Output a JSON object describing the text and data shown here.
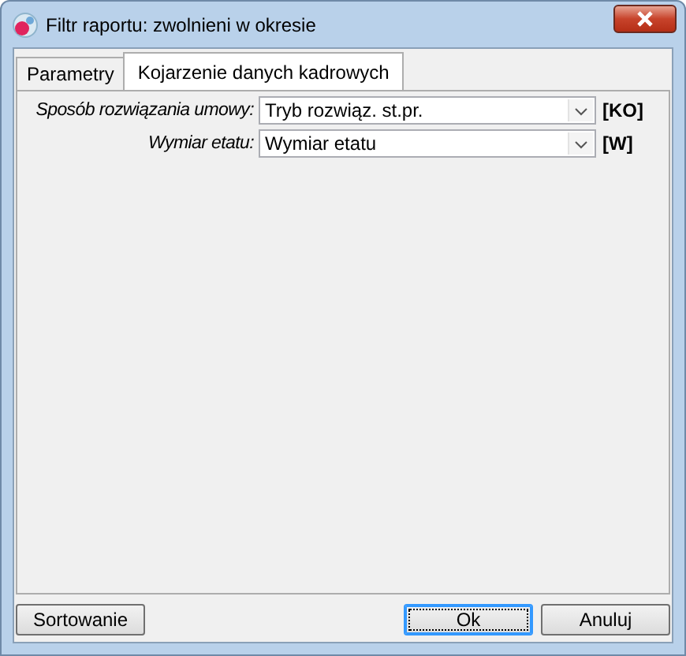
{
  "window": {
    "title": "Filtr raportu: zwolnieni w okresie"
  },
  "tabs": [
    {
      "label": "Parametry",
      "selected": false
    },
    {
      "label": "Kojarzenie danych kadrowych",
      "selected": true
    }
  ],
  "fields": [
    {
      "label": "Sposób rozwiązania umowy:",
      "value": "Tryb rozwiąz. st.pr.",
      "code": "[KO]"
    },
    {
      "label": "Wymiar etatu:",
      "value": "Wymiar etatu",
      "code": "[W]"
    }
  ],
  "buttons": [
    {
      "label": "Sortowanie",
      "default": false
    },
    {
      "label": "Ok",
      "default": true
    },
    {
      "label": "Anuluj",
      "default": false
    }
  ]
}
